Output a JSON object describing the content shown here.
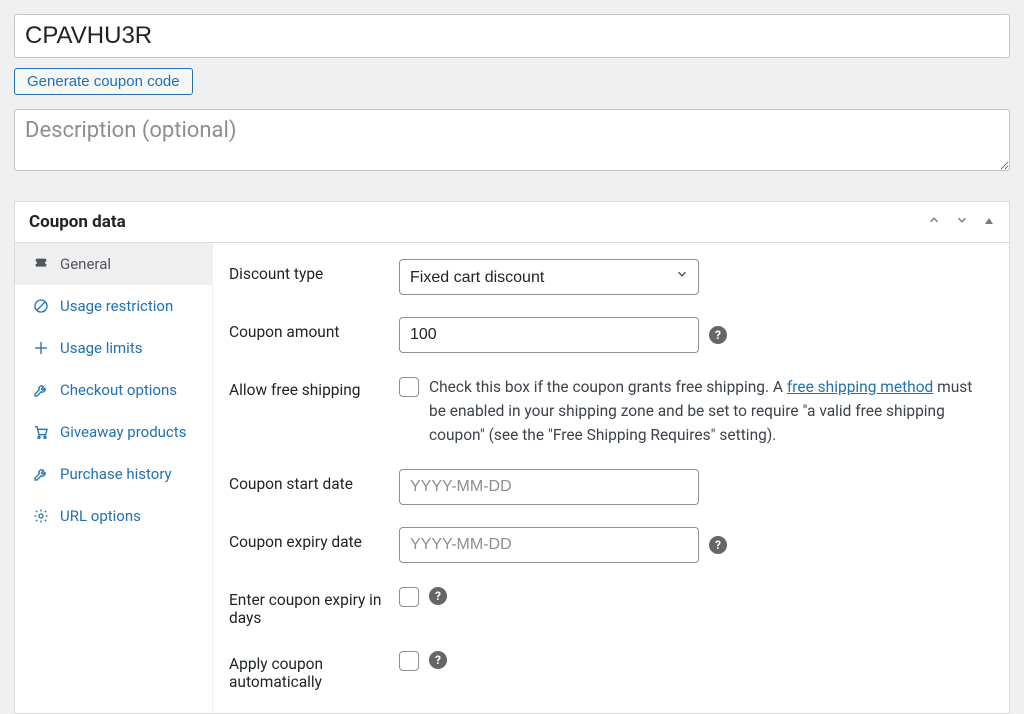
{
  "coupon": {
    "code_value": "CPAVHU3R",
    "generate_button": "Generate coupon code",
    "description_placeholder": "Description (optional)"
  },
  "panel": {
    "title": "Coupon data",
    "toggles": {
      "move_up": "⌃",
      "move_down": "⌄",
      "collapse": "▴"
    }
  },
  "sidebar": {
    "items": [
      {
        "icon": "🎟",
        "label": "General"
      },
      {
        "icon": "⊘",
        "label": "Usage restriction"
      },
      {
        "icon": "⇥",
        "label": "Usage limits"
      },
      {
        "icon": "🔧",
        "label": "Checkout options"
      },
      {
        "icon": "🛒",
        "label": "Giveaway products"
      },
      {
        "icon": "🔧",
        "label": "Purchase history"
      },
      {
        "icon": "⌖",
        "label": "URL options"
      }
    ]
  },
  "form": {
    "discount_type": {
      "label": "Discount type",
      "selected": "Fixed cart discount"
    },
    "coupon_amount": {
      "label": "Coupon amount",
      "value": "100"
    },
    "allow_free_shipping": {
      "label": "Allow free shipping",
      "help_pre": "Check this box if the coupon grants free shipping. A ",
      "link_text": "free shipping method",
      "help_post": " must be enabled in your shipping zone and be set to require \"a valid free shipping coupon\" (see the \"Free Shipping Requires\" setting)."
    },
    "coupon_start": {
      "label": "Coupon start date",
      "placeholder": "YYYY-MM-DD"
    },
    "coupon_expiry": {
      "label": "Coupon expiry date",
      "placeholder": "YYYY-MM-DD"
    },
    "expiry_days": {
      "label": "Enter coupon expiry in days"
    },
    "apply_auto": {
      "label": "Apply coupon automatically"
    }
  }
}
